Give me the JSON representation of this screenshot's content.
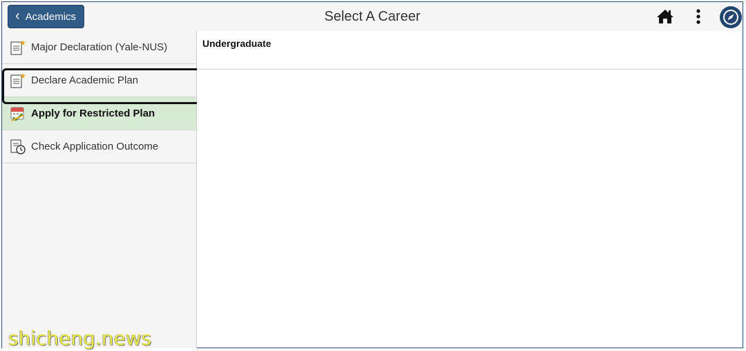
{
  "header": {
    "back_label": "Academics",
    "title": "Select A Career",
    "icons": [
      "home-icon",
      "more-options-icon",
      "navbar-compass-icon"
    ]
  },
  "sidebar": {
    "items": [
      {
        "label": "Major Declaration (Yale-NUS)",
        "icon": "form-star-icon",
        "active": false
      },
      {
        "label": "Declare Academic Plan",
        "icon": "form-star-icon",
        "active": false
      },
      {
        "label": "Apply for Restricted Plan",
        "icon": "calendar-check-icon",
        "active": true
      },
      {
        "label": "Check Application Outcome",
        "icon": "document-clock-icon",
        "active": false
      }
    ]
  },
  "main": {
    "careers": [
      "Undergraduate"
    ]
  },
  "watermark": "shicheng.news",
  "colors": {
    "back_button": "#2f5b86",
    "active_item": "#d7ead4",
    "frame_border": "#2b4a74"
  }
}
